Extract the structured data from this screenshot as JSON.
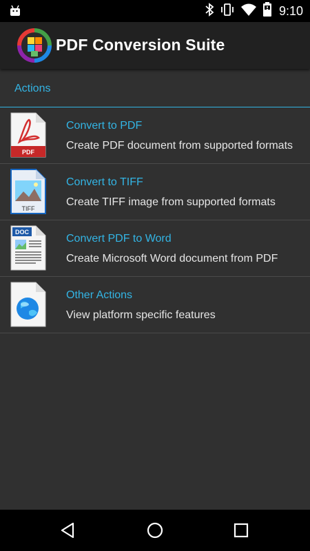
{
  "status_bar": {
    "time": "9:10",
    "icons": [
      "android-icon",
      "bluetooth-icon",
      "vibrate-icon",
      "wifi-icon",
      "battery-icon"
    ]
  },
  "app_bar": {
    "title": "PDF Conversion Suite",
    "logo_icon": "app-logo-icon"
  },
  "section": {
    "title": "Actions",
    "accent_color": "#33b5e5"
  },
  "items": [
    {
      "title": "Convert to PDF",
      "description": "Create PDF document from supported formats",
      "icon": "pdf-file-icon",
      "icon_label": "PDF"
    },
    {
      "title": "Convert to TIFF",
      "description": "Create TIFF image from supported formats",
      "icon": "tiff-file-icon",
      "icon_label": "TIFF"
    },
    {
      "title": "Convert PDF to Word",
      "description": "Create Microsoft Word document from PDF",
      "icon": "doc-file-icon",
      "icon_label": "DOC"
    },
    {
      "title": "Other Actions",
      "description": "View platform specific features",
      "icon": "globe-file-icon"
    }
  ],
  "nav_bar": {
    "buttons": [
      "back-icon",
      "home-icon",
      "recents-icon"
    ]
  }
}
